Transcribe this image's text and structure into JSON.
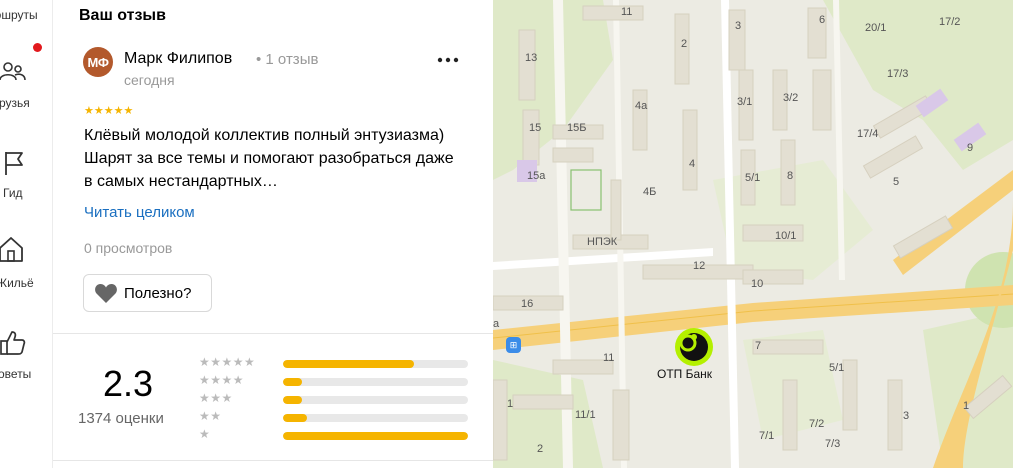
{
  "rail": {
    "items": [
      {
        "label": "рошруты",
        "icon": "route-icon"
      },
      {
        "label": "рузья",
        "icon": "friends-icon"
      },
      {
        "label": "Гид",
        "icon": "flag-icon"
      },
      {
        "label": "Жильё",
        "icon": "house-icon"
      },
      {
        "label": "оветы",
        "icon": "thumbs-up-icon"
      }
    ]
  },
  "panel": {
    "heading": "Ваш отзыв",
    "review": {
      "avatar_initials": "МФ",
      "avatar_color": "#b3592c",
      "author": "Марк Филипов",
      "meta": "• 1 отзыв",
      "date": "сегодня",
      "rating": 5,
      "stars": "★★★★★",
      "text": "Клёвый молодой коллектив полный энтузиазма) Шарят за все темы и помогают разобраться даже в самых нестандартных…",
      "read_more": "Читать целиком",
      "views": "0 просмотров",
      "useful_label": "Полезно?"
    },
    "summary": {
      "score": "2.3",
      "ratings_count": "1374 оценки",
      "distribution": [
        {
          "stars": "★★★★★",
          "fraction": 0.71
        },
        {
          "stars": "★★★★",
          "fraction": 0.1
        },
        {
          "stars": "★★★",
          "fraction": 0.1
        },
        {
          "stars": "★★",
          "fraction": 0.13
        },
        {
          "stars": "★",
          "fraction": 1.0
        }
      ]
    },
    "accent_color": "#f5b400",
    "link_color": "#1a6fc0"
  },
  "map": {
    "poi_label": "ОТП Банк",
    "poi_color": "#b4f000",
    "house_numbers": [
      "11",
      "13",
      "15",
      "15Б",
      "15а",
      "4а",
      "4",
      "4Б",
      "2",
      "3",
      "6",
      "3/1",
      "3/2",
      "20/1",
      "17/2",
      "17/3",
      "17/4",
      "9",
      "5",
      "5/1",
      "8",
      "10/1",
      "12",
      "10",
      "16",
      "11",
      "11/1",
      "7",
      "5/1",
      "7/2",
      "7/3",
      "7/1",
      "3",
      "1",
      "2",
      "1",
      "а"
    ],
    "building_label": "НПЭК",
    "bus_stop": "bus-stop-icon"
  }
}
